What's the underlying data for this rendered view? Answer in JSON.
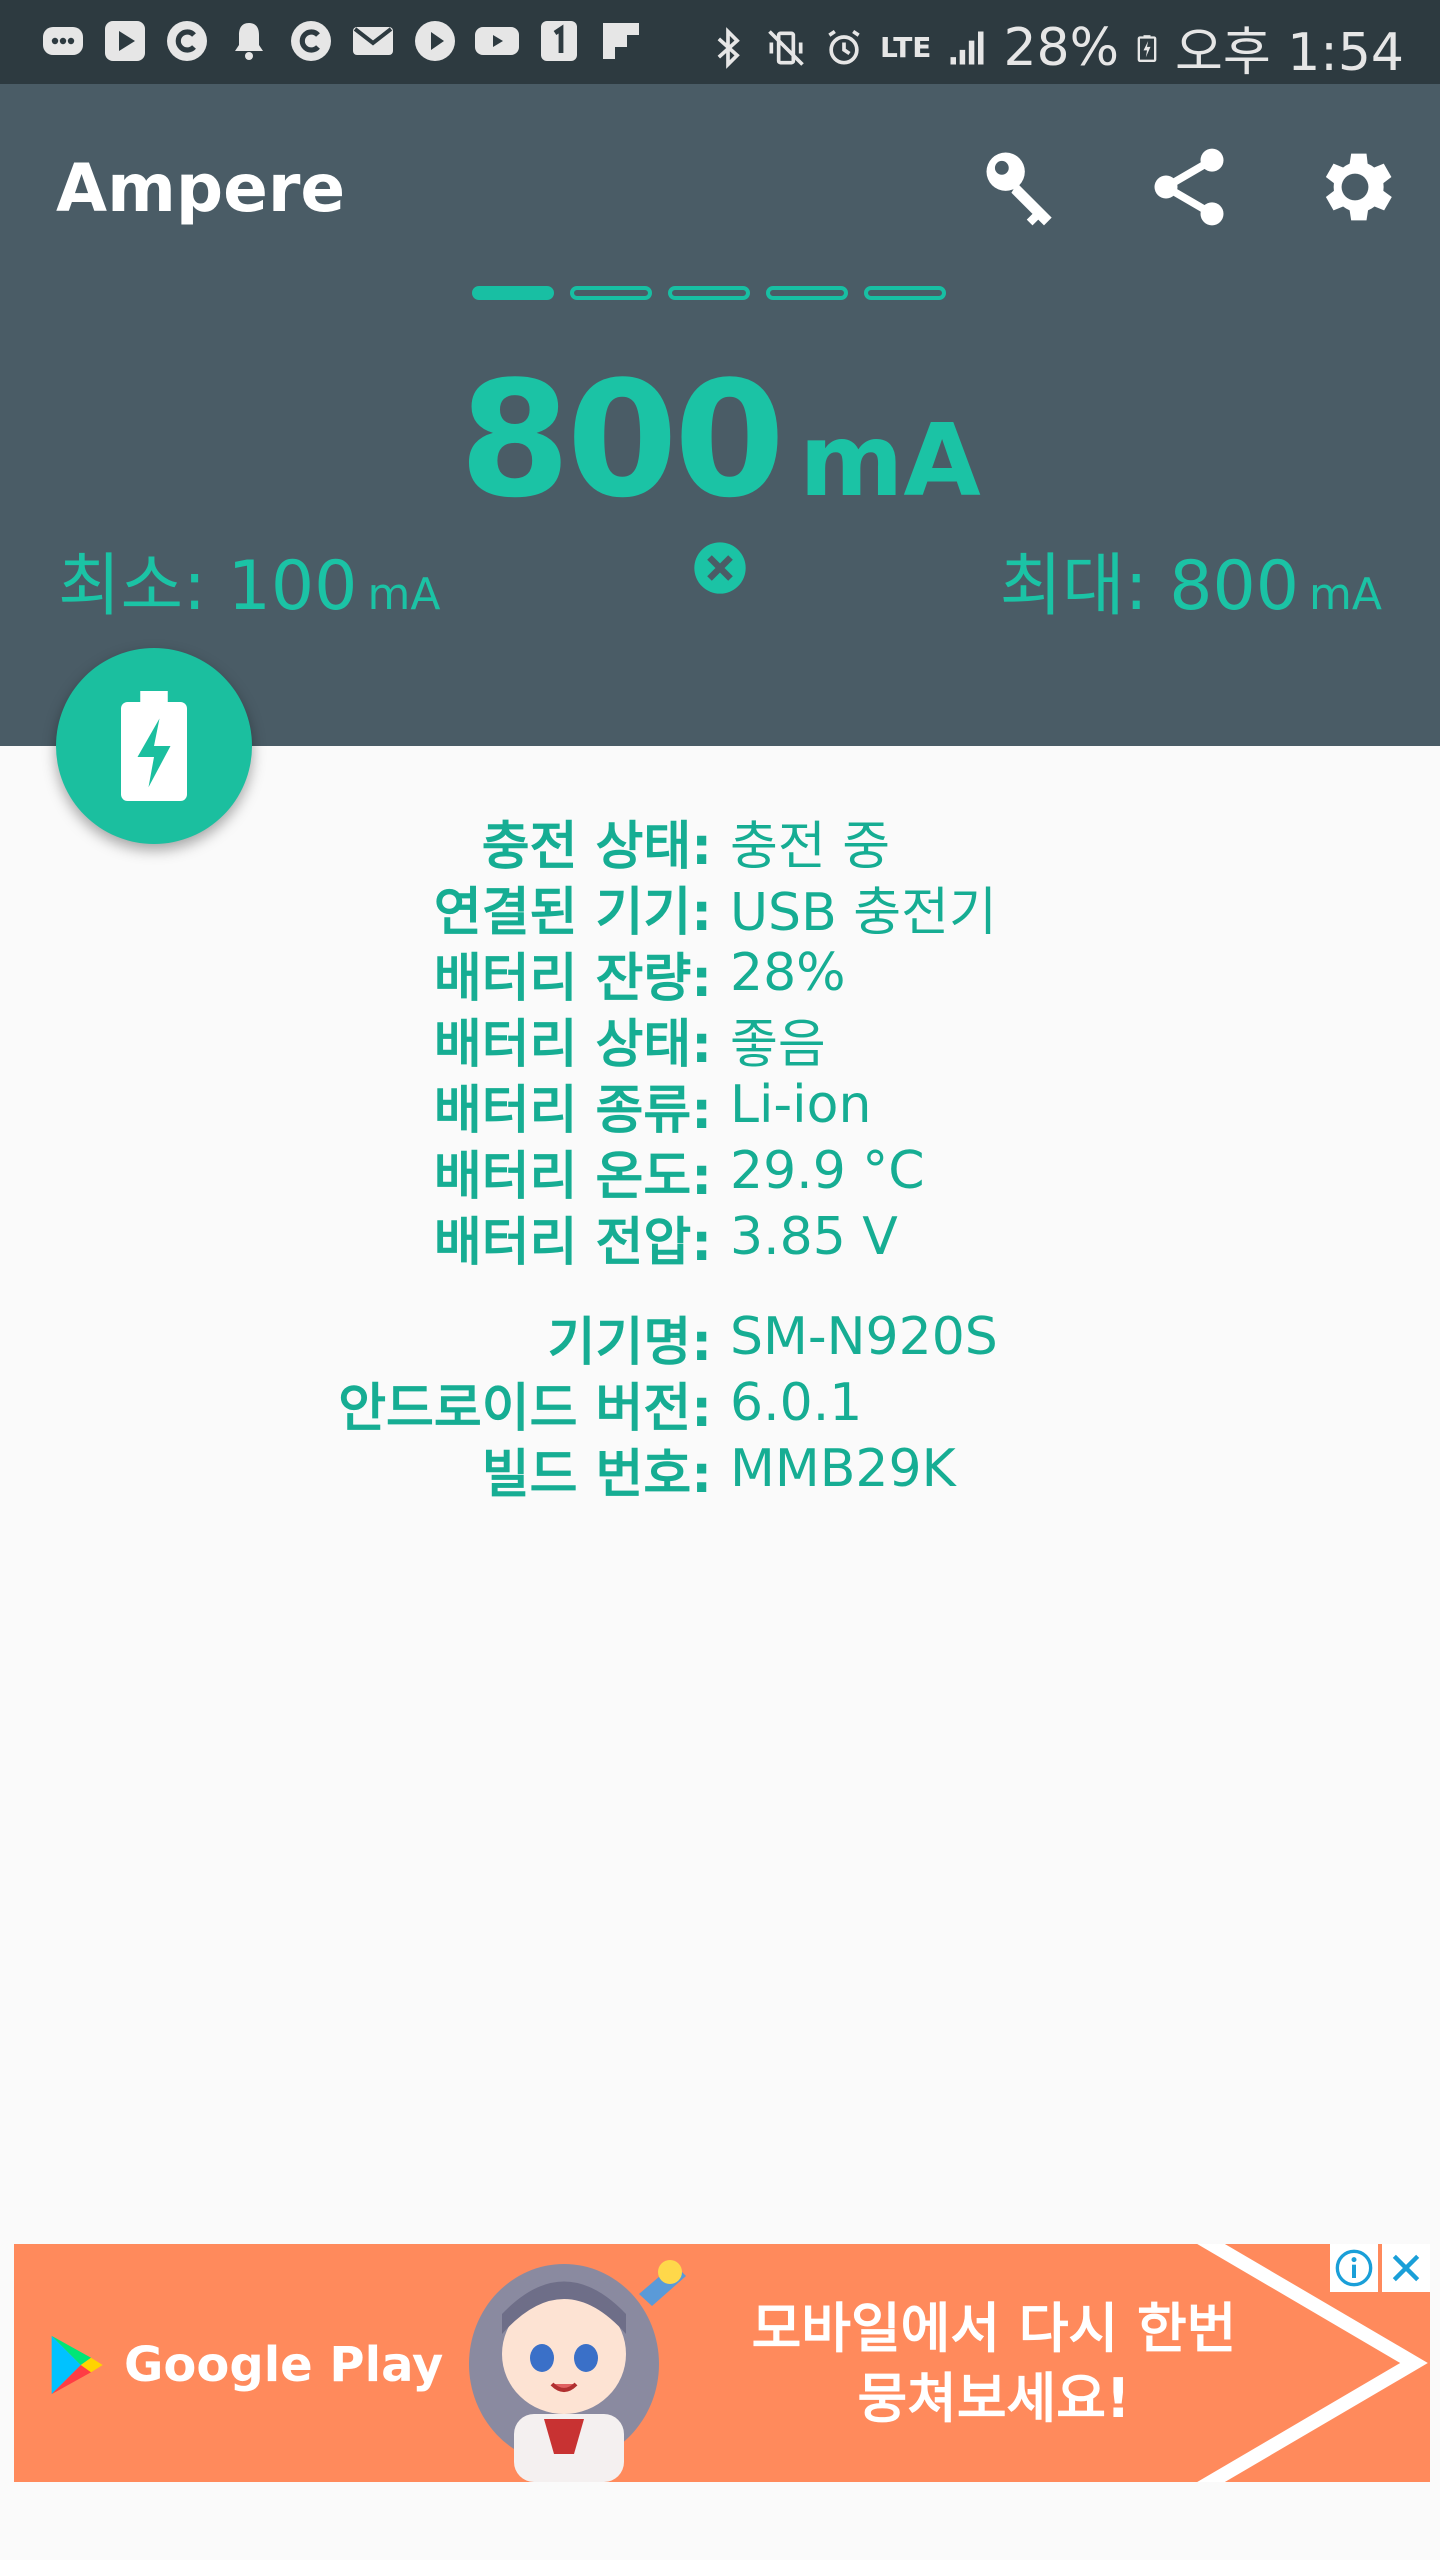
{
  "status_bar": {
    "battery_percent": "28%",
    "time": "오후 1:54",
    "network": "LTE"
  },
  "app": {
    "title": "Ampere"
  },
  "toolbar": {
    "icons": [
      "key-icon",
      "share-icon",
      "settings-icon"
    ]
  },
  "pager": {
    "count": 5,
    "active_index": 0
  },
  "reading": {
    "value": "800",
    "unit": "mA"
  },
  "min": {
    "label": "최소:",
    "value": "100",
    "unit": "mA"
  },
  "max": {
    "label": "최대:",
    "value": "800",
    "unit": "mA"
  },
  "battery_info": [
    {
      "label": "충전 상태:",
      "value": "충전 중"
    },
    {
      "label": "연결된 기기:",
      "value": "USB 충전기"
    },
    {
      "label": "배터리 잔량:",
      "value": "28%"
    },
    {
      "label": "배터리 상태:",
      "value": "좋음"
    },
    {
      "label": "배터리 종류:",
      "value": "Li-ion"
    },
    {
      "label": "배터리 온도:",
      "value": "29.9 °C"
    },
    {
      "label": "배터리 전압:",
      "value": "3.85 V"
    }
  ],
  "device_info": [
    {
      "label": "기기명:",
      "value": "SM-N920S"
    },
    {
      "label": "안드로이드 버전:",
      "value": "6.0.1"
    },
    {
      "label": "빌드 번호:",
      "value": "MMB29K"
    }
  ],
  "ad": {
    "brand": "Google Play",
    "line1": "모바일에서 다시 한번",
    "line2": "뭉쳐보세요!"
  },
  "colors": {
    "accent": "#1bc3a5",
    "header_bg": "#4a5c66",
    "status_bg": "#2d3a40",
    "ad_bg": "#ff8a5c"
  }
}
